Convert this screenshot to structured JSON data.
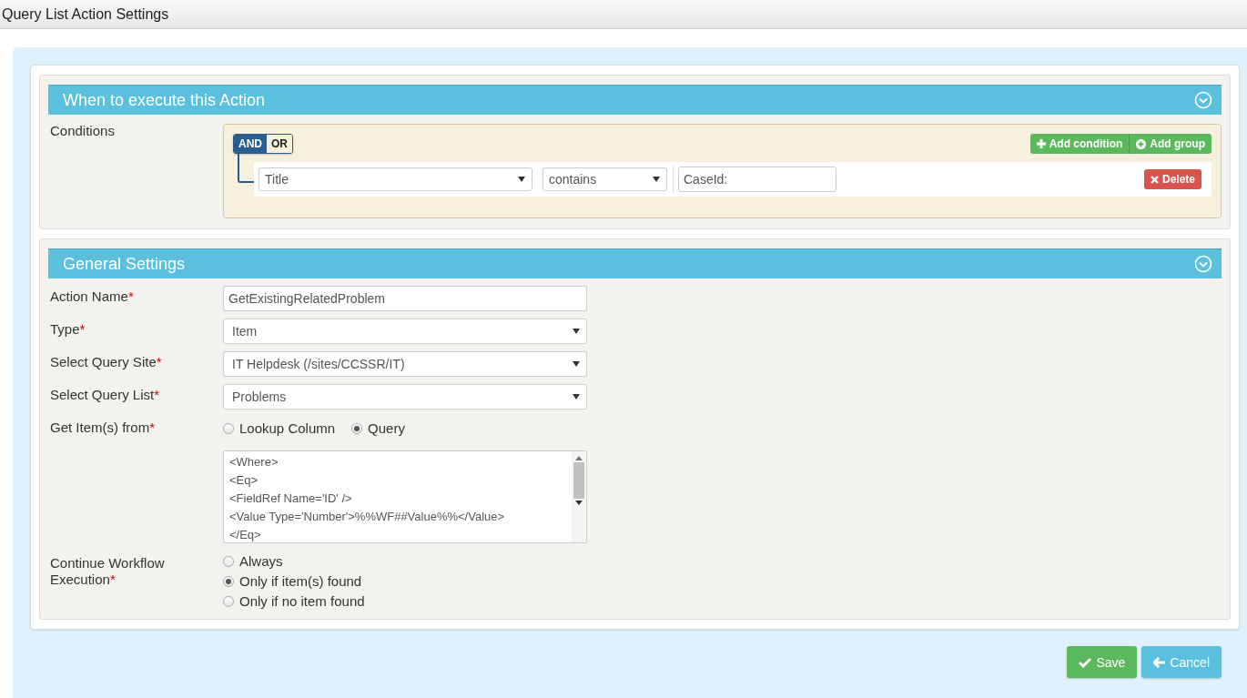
{
  "window": {
    "title": "Query List Action Settings"
  },
  "sections": [
    {
      "title": "When to execute this Action",
      "expanded": true,
      "kind": "conditions"
    },
    {
      "title": "General Settings",
      "expanded": true,
      "kind": "settings"
    }
  ],
  "conditions": {
    "label": "Conditions",
    "operators": [
      {
        "label": "AND",
        "selected": true
      },
      {
        "label": "OR",
        "selected": false
      }
    ],
    "add_condition": "Add condition",
    "add_group": "Add group",
    "rule": {
      "field": "Title",
      "operator": "contains",
      "value": "CaseId:",
      "delete": "Delete"
    }
  },
  "settings": [
    {
      "kind": "text",
      "label": "Action Name",
      "mark": "*",
      "value": "GetExistingRelatedProblem"
    },
    {
      "kind": "select",
      "label": "Type",
      "mark": "*",
      "value": "Item"
    },
    {
      "kind": "select",
      "label": "Select Query Site",
      "mark": "*",
      "value": "IT Helpdesk (/sites/CCSSR/IT)"
    },
    {
      "kind": "select",
      "label": "Select Query List",
      "mark": "*",
      "value": "Problems"
    },
    {
      "kind": "radio-inline",
      "label": "Get Item(s) from",
      "mark": "*",
      "options": [
        {
          "label": "Lookup Column",
          "selected": false
        },
        {
          "label": "Query",
          "selected": true
        }
      ]
    },
    {
      "kind": "textarea",
      "lines": [
        "<Where>",
        "<Eq>",
        "<FieldRef Name='ID' />",
        "<Value Type='Number'>%%WF##Value%%</Value>",
        "</Eq>"
      ]
    },
    {
      "kind": "radio-stack",
      "label": "Continue Workflow Execution",
      "mark": "*",
      "options": [
        {
          "label": "Always",
          "selected": false
        },
        {
          "label": "Only if item(s) found",
          "selected": true
        },
        {
          "label": "Only if no item found",
          "selected": false
        }
      ]
    }
  ],
  "buttons": [
    {
      "kind": "save",
      "label": "Save"
    },
    {
      "kind": "cancel",
      "label": "Cancel"
    }
  ]
}
